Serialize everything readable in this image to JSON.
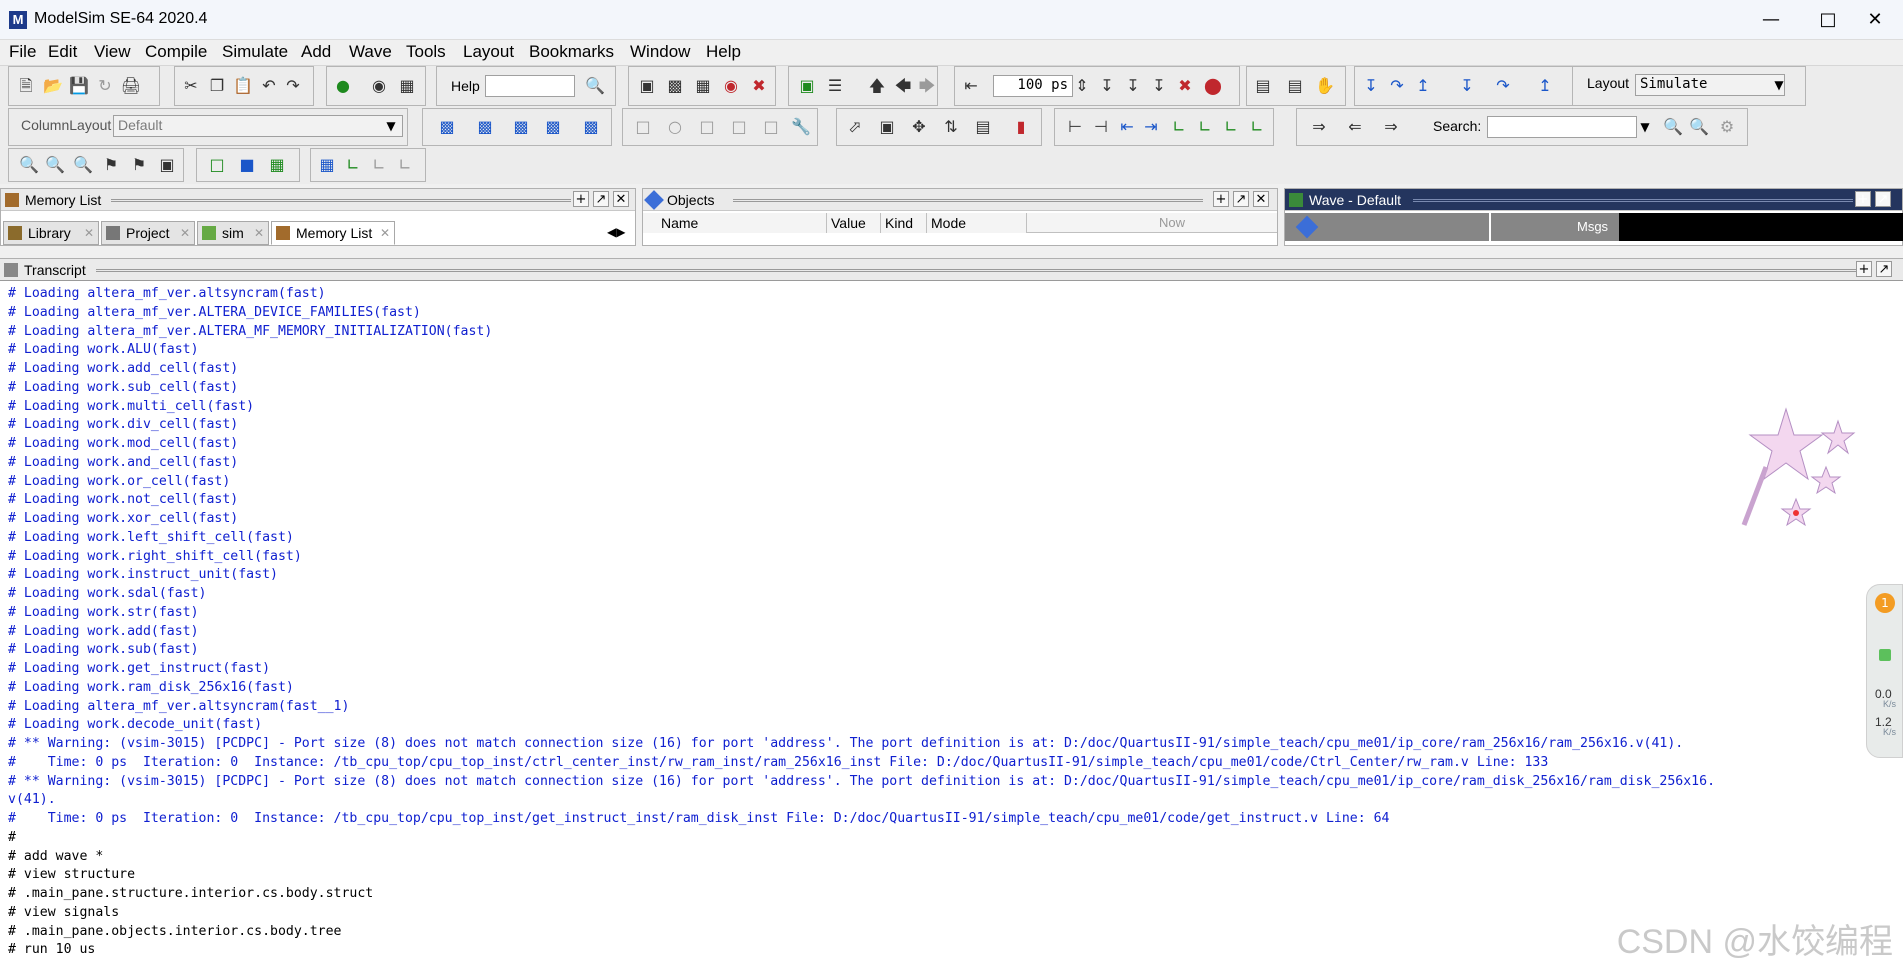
{
  "window": {
    "title": "ModelSim SE-64 2020.4",
    "icon_letter": "M"
  },
  "menu": [
    "File",
    "Edit",
    "View",
    "Compile",
    "Simulate",
    "Add",
    "Wave",
    "Tools",
    "Layout",
    "Bookmarks",
    "Window",
    "Help"
  ],
  "toolbar": {
    "help_label": "Help",
    "help_value": "",
    "run_length_value": "100 ps",
    "layout_label": "Layout",
    "layout_value": "Simulate",
    "column_layout_label": "ColumnLayout",
    "column_layout_value": "Default",
    "search_label": "Search:",
    "search_value": ""
  },
  "panels": {
    "memory_list": {
      "title": "Memory List",
      "tabs": [
        "Library",
        "Project",
        "sim",
        "Memory List"
      ],
      "active_tab": "Memory List"
    },
    "objects": {
      "title": "Objects",
      "columns": [
        "Name",
        "Value",
        "Kind",
        "Mode"
      ],
      "now_label": "Now"
    },
    "wave": {
      "title": "Wave - Default",
      "msgs_label": "Msgs"
    },
    "transcript": {
      "title": "Transcript"
    }
  },
  "transcript_lines": [
    {
      "text": "# Loading altera_mf_ver.altsyncram(fast)",
      "kind": "loading"
    },
    {
      "text": "# Loading altera_mf_ver.ALTERA_DEVICE_FAMILIES(fast)",
      "kind": "loading"
    },
    {
      "text": "# Loading altera_mf_ver.ALTERA_MF_MEMORY_INITIALIZATION(fast)",
      "kind": "loading"
    },
    {
      "text": "# Loading work.ALU(fast)",
      "kind": "loading"
    },
    {
      "text": "# Loading work.add_cell(fast)",
      "kind": "loading"
    },
    {
      "text": "# Loading work.sub_cell(fast)",
      "kind": "loading"
    },
    {
      "text": "# Loading work.multi_cell(fast)",
      "kind": "loading"
    },
    {
      "text": "# Loading work.div_cell(fast)",
      "kind": "loading"
    },
    {
      "text": "# Loading work.mod_cell(fast)",
      "kind": "loading"
    },
    {
      "text": "# Loading work.and_cell(fast)",
      "kind": "loading"
    },
    {
      "text": "# Loading work.or_cell(fast)",
      "kind": "loading"
    },
    {
      "text": "# Loading work.not_cell(fast)",
      "kind": "loading"
    },
    {
      "text": "# Loading work.xor_cell(fast)",
      "kind": "loading"
    },
    {
      "text": "# Loading work.left_shift_cell(fast)",
      "kind": "loading"
    },
    {
      "text": "# Loading work.right_shift_cell(fast)",
      "kind": "loading"
    },
    {
      "text": "# Loading work.instruct_unit(fast)",
      "kind": "loading"
    },
    {
      "text": "# Loading work.sdal(fast)",
      "kind": "loading"
    },
    {
      "text": "# Loading work.str(fast)",
      "kind": "loading"
    },
    {
      "text": "# Loading work.add(fast)",
      "kind": "loading"
    },
    {
      "text": "# Loading work.sub(fast)",
      "kind": "loading"
    },
    {
      "text": "# Loading work.get_instruct(fast)",
      "kind": "loading"
    },
    {
      "text": "# Loading work.ram_disk_256x16(fast)",
      "kind": "loading"
    },
    {
      "text": "# Loading altera_mf_ver.altsyncram(fast__1)",
      "kind": "loading"
    },
    {
      "text": "# Loading work.decode_unit(fast)",
      "kind": "loading"
    },
    {
      "text": "# ** Warning: (vsim-3015) [PCDPC] - Port size (8) does not match connection size (16) for port 'address'. The port definition is at: D:/doc/QuartusII-91/simple_teach/cpu_me01/ip_core/ram_256x16/ram_256x16.v(41).",
      "kind": "warning"
    },
    {
      "text": "#    Time: 0 ps  Iteration: 0  Instance: /tb_cpu_top/cpu_top_inst/ctrl_center_inst/rw_ram_inst/ram_256x16_inst File: D:/doc/QuartusII-91/simple_teach/cpu_me01/code/Ctrl_Center/rw_ram.v Line: 133",
      "kind": "warning"
    },
    {
      "text": "# ** Warning: (vsim-3015) [PCDPC] - Port size (8) does not match connection size (16) for port 'address'. The port definition is at: D:/doc/QuartusII-91/simple_teach/cpu_me01/ip_core/ram_disk_256x16/ram_disk_256x16.",
      "kind": "warning"
    },
    {
      "text": "v(41).",
      "kind": "warning"
    },
    {
      "text": "#    Time: 0 ps  Iteration: 0  Instance: /tb_cpu_top/cpu_top_inst/get_instruct_inst/ram_disk_inst File: D:/doc/QuartusII-91/simple_teach/cpu_me01/code/get_instruct.v Line: 64",
      "kind": "warning"
    },
    {
      "text": "#",
      "kind": "cmd"
    },
    {
      "text": "# add wave *",
      "kind": "cmd"
    },
    {
      "text": "# view structure",
      "kind": "cmd"
    },
    {
      "text": "# .main_pane.structure.interior.cs.body.struct",
      "kind": "cmd"
    },
    {
      "text": "# view signals",
      "kind": "cmd"
    },
    {
      "text": "# .main_pane.objects.interior.cs.body.tree",
      "kind": "cmd"
    },
    {
      "text": "# run 10 us",
      "kind": "cmd"
    }
  ],
  "net_widget": {
    "badge": "1",
    "down_speed": "0.0",
    "down_unit": "K/s",
    "up_speed": "1.2",
    "up_unit": "K/s"
  },
  "watermark": "CSDN @水饺编程",
  "colors": {
    "transcript_blue": "#1020d0",
    "wave_header": "#24355e"
  }
}
